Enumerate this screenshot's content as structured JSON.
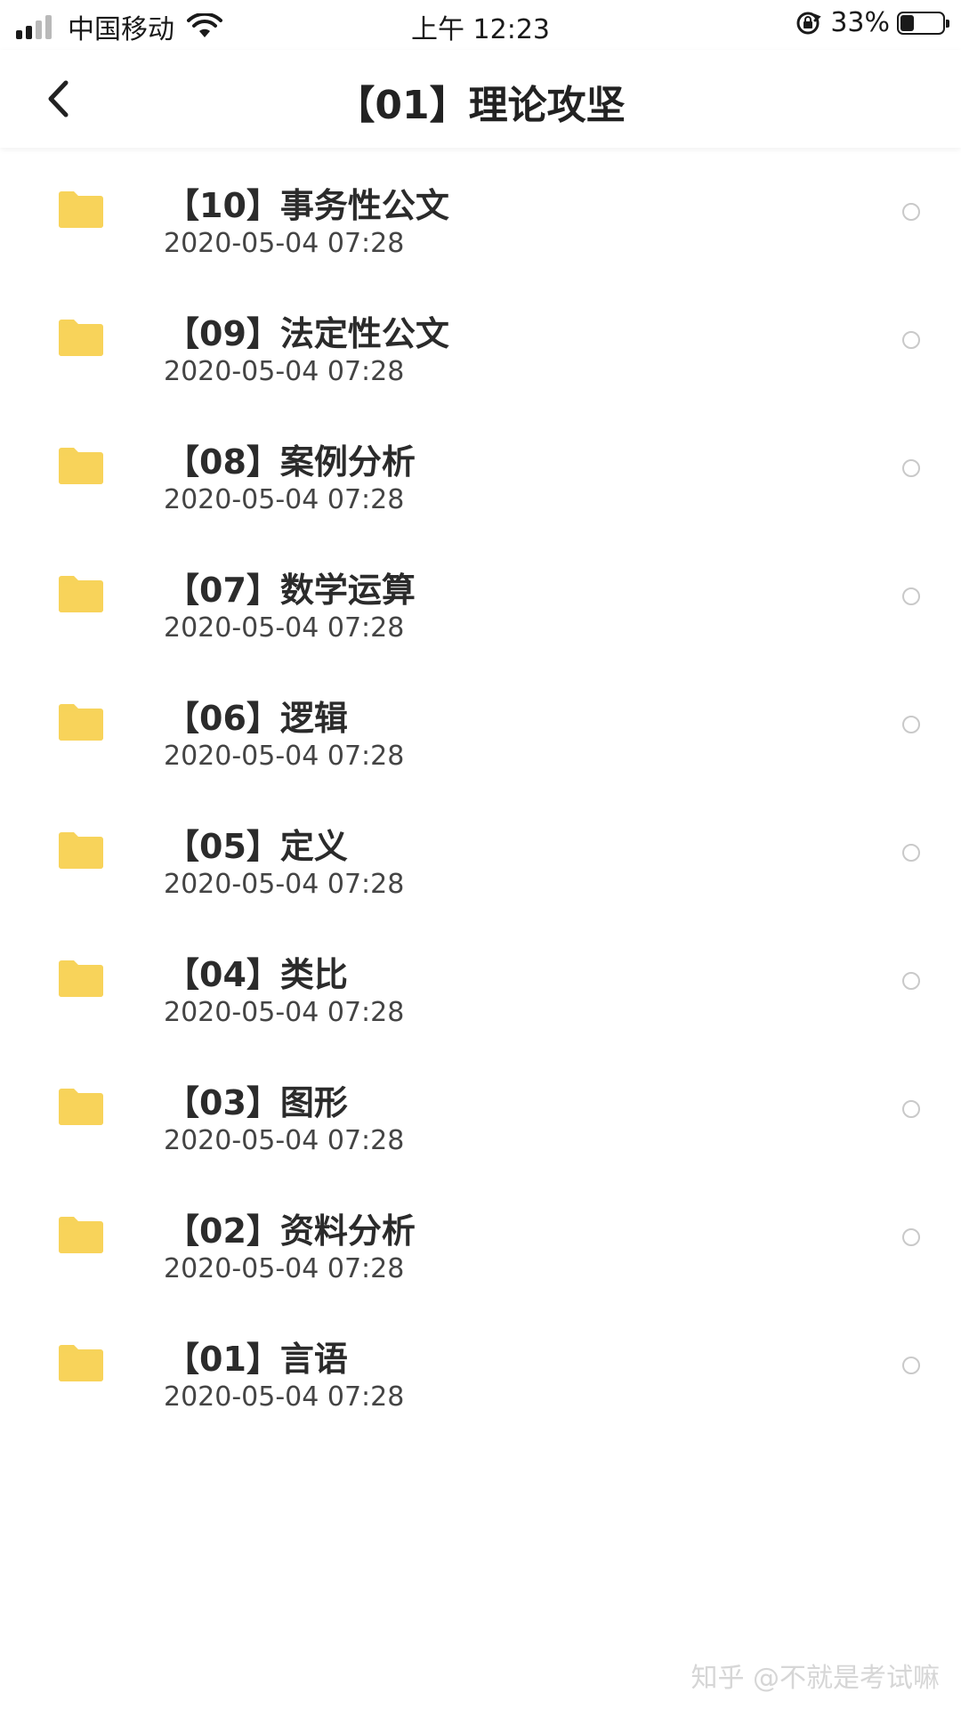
{
  "status_bar": {
    "carrier": "中国移动",
    "time": "上午 12:23",
    "battery_text": "33%",
    "battery_level": 0.33
  },
  "nav": {
    "title": "【01】理论攻坚",
    "back_icon": "chevron-left-icon"
  },
  "folder_color": "#f7d35a",
  "files": [
    {
      "name": "【10】事务性公文",
      "date": "2020-05-04 07:28"
    },
    {
      "name": "【09】法定性公文",
      "date": "2020-05-04 07:28"
    },
    {
      "name": "【08】案例分析",
      "date": "2020-05-04 07:28"
    },
    {
      "name": "【07】数学运算",
      "date": "2020-05-04 07:28"
    },
    {
      "name": "【06】逻辑",
      "date": "2020-05-04 07:28"
    },
    {
      "name": "【05】定义",
      "date": "2020-05-04 07:28"
    },
    {
      "name": "【04】类比",
      "date": "2020-05-04 07:28"
    },
    {
      "name": "【03】图形",
      "date": "2020-05-04 07:28"
    },
    {
      "name": "【02】资料分析",
      "date": "2020-05-04 07:28"
    },
    {
      "name": "【01】言语",
      "date": "2020-05-04 07:28"
    }
  ],
  "watermark": "知乎 @不就是考试嘛"
}
